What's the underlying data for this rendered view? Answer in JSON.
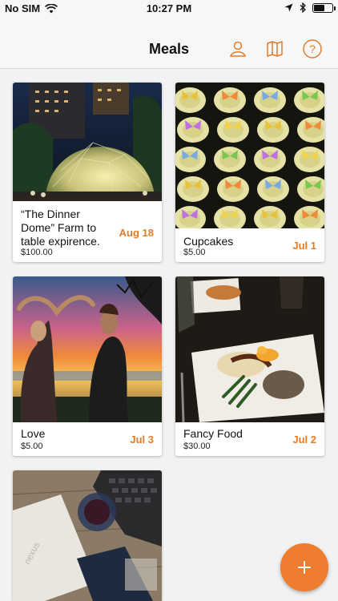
{
  "status": {
    "carrier": "No SIM",
    "time": "10:27 PM",
    "battery_level": 0.6
  },
  "nav": {
    "title": "Meals",
    "icons": [
      "person-icon",
      "map-icon",
      "help-icon"
    ]
  },
  "meals": [
    {
      "title": "“The Dinner Dome” Farm to table expirence.",
      "price": "$100.00",
      "date": "Aug 18"
    },
    {
      "title": "Cupcakes",
      "price": "$5.00",
      "date": "Jul 1"
    },
    {
      "title": "Love",
      "price": "$5.00",
      "date": "Jul 3"
    },
    {
      "title": "Fancy Food",
      "price": "$30.00",
      "date": "Jul 2"
    },
    {
      "title": "",
      "price": "",
      "date": ""
    }
  ],
  "fab": {
    "label": "+"
  },
  "colors": {
    "accent": "#ef7d2f",
    "date": "#e07b2a"
  }
}
